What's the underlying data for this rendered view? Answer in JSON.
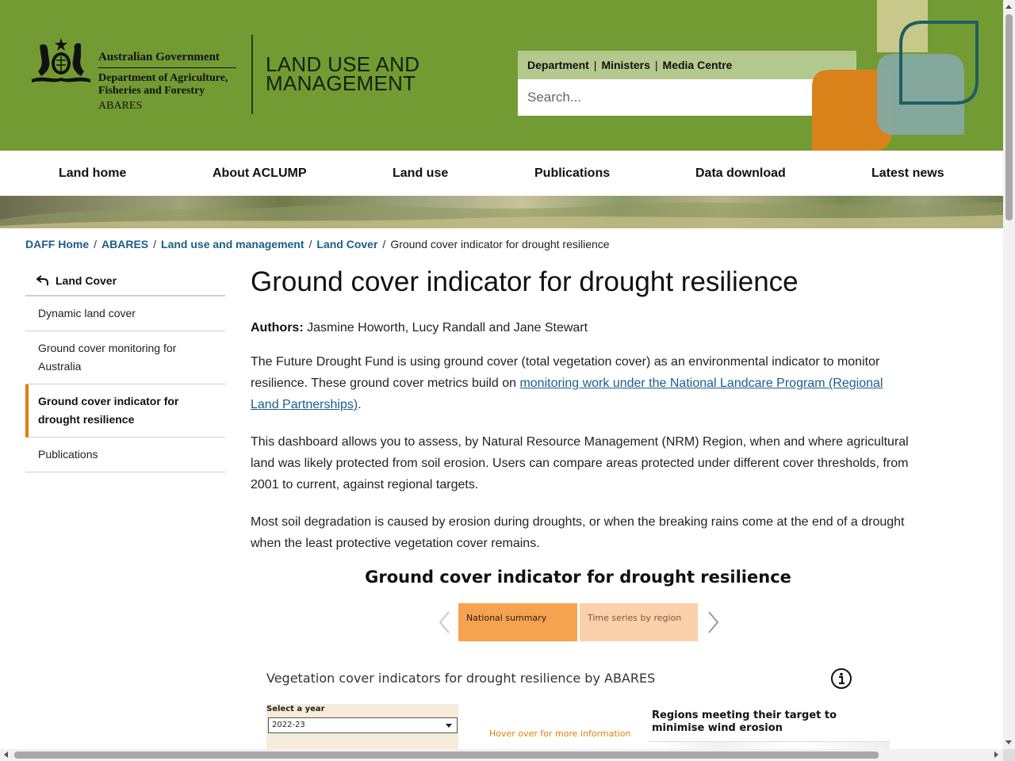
{
  "header": {
    "gov_title": "Australian Government",
    "gov_dept": "Department of Agriculture, Fisheries and Forestry",
    "gov_abares": "ABARES",
    "site_title": "LAND USE AND MANAGEMENT",
    "utility_links": [
      "Department",
      "Ministers",
      "Media Centre"
    ],
    "search_placeholder": "Search...",
    "colors": {
      "green": "#739b33",
      "light_green": "#b3c98e",
      "orange": "#d9821a",
      "teal": "#1f5e61"
    }
  },
  "nav": {
    "items": [
      "Land home",
      "About ACLUMP",
      "Land use",
      "Publications",
      "Data download",
      "Latest news"
    ]
  },
  "breadcrumb": {
    "items": [
      "DAFF Home",
      "ABARES",
      "Land use and management",
      "Land Cover"
    ],
    "current": "Ground cover indicator for drought resilience"
  },
  "sidenav": {
    "back_label": "Land Cover",
    "items": [
      {
        "label": "Dynamic land cover",
        "active": false
      },
      {
        "label": "Ground cover monitoring for Australia",
        "active": false
      },
      {
        "label": "Ground cover indicator for drought resilience",
        "active": true
      },
      {
        "label": "Publications",
        "active": false
      }
    ],
    "accent": "#e07d10"
  },
  "main": {
    "title": "Ground cover indicator for drought resilience",
    "authors_label": "Authors:",
    "authors": "Jasmine Howorth, Lucy Randall and Jane Stewart",
    "p1_text": "The Future Drought Fund is using ground cover (total vegetation cover) as an environmental indicator to monitor resilience. These ground cover metrics build on ",
    "p1_link": "monitoring work under the National Landcare Program (Regional Land Partnerships)",
    "p1_end": ".",
    "p2": "This dashboard allows you to assess, by Natural Resource Management (NRM) Region, when and where agricultural land was likely protected from soil erosion. Users can compare areas protected under different cover thresholds, from 2001 to current, against regional targets.",
    "p3": "Most soil degradation is caused by erosion during droughts, or when the breaking rains come at the end of a drought when the least protective vegetation cover remains."
  },
  "dashboard": {
    "title": "Ground cover indicator for drought resilience",
    "tabs": [
      {
        "label": "National summary",
        "active": true
      },
      {
        "label": "Time series by region",
        "active": false
      }
    ],
    "viz_title": "Vegetation cover indicators for drought resilience by ABARES",
    "select_label": "Select a year",
    "selected_year": "2022-23",
    "hover_hint": "Hover over for more information",
    "regions_title": "Regions meeting their target to minimise wind erosion"
  }
}
